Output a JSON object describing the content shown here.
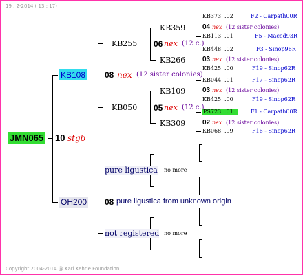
{
  "header_date": "19 .  2-2014 ( 13 : 17)",
  "footer": "Copyright 2004-2014 @ Karl Kehrle Foundation.",
  "root": {
    "label": "JMN065",
    "gen": "10",
    "name": "stgb"
  },
  "sire": {
    "label": "KB108",
    "gen": "08",
    "name": "nex",
    "sisters": "(12 sister colonies)"
  },
  "dam": {
    "label": "OH200",
    "gen": "08",
    "text": "pure ligustica from unknown origin"
  },
  "level3": [
    {
      "label": "KB255",
      "gen": "06",
      "name": "nex",
      "count": "(12 c.)"
    },
    {
      "label": "KB050",
      "gen": "05",
      "name": "nex",
      "count": "(12 c.)"
    },
    {
      "label": "pure ligustica",
      "no_more": "no more"
    },
    {
      "label": "not registered",
      "no_more": "no more"
    }
  ],
  "level4": [
    {
      "label": "KB359",
      "gen": "04",
      "name": "nex",
      "sisters": "(12 sister colonies)"
    },
    {
      "label": "KB266",
      "gen": "03",
      "name": "nex",
      "sisters": "(12 sister colonies)"
    },
    {
      "label": "KB109",
      "gen": "03",
      "name": "nex",
      "sisters": "(12 sister colonies)"
    },
    {
      "label": "KB309",
      "gen": "02",
      "name": "nex",
      "sisters": "(12 sister colonies)"
    }
  ],
  "right_col": [
    {
      "id": "KB373",
      "val": ".02",
      "code": "F2 - Carpath00R"
    },
    {
      "id": "KB113",
      "val": ".01",
      "code": "F5 - Maced93R"
    },
    {
      "id": "KB448",
      "val": ".02",
      "code": "F3 - Sinop96R"
    },
    {
      "id": "KB425",
      "val": ".00",
      "code": "F19 - Sinop62R"
    },
    {
      "id": "KB044",
      "val": ".01",
      "code": "F17 - Sinop62R"
    },
    {
      "id": "KB425",
      "val": ".00",
      "code": "F19 - Sinop62R"
    },
    {
      "id": "PS723",
      "val": ".01",
      "code": "F1 - Carpath00R"
    },
    {
      "id": "KB068",
      "val": ".99",
      "code": "F16 - Sinop62R"
    }
  ],
  "colors": {
    "border": "#ff33aa",
    "root_bg": "#33dd33",
    "sire_bg": "#33ddee",
    "nex": "#dd0000",
    "link": "#0000cc"
  }
}
